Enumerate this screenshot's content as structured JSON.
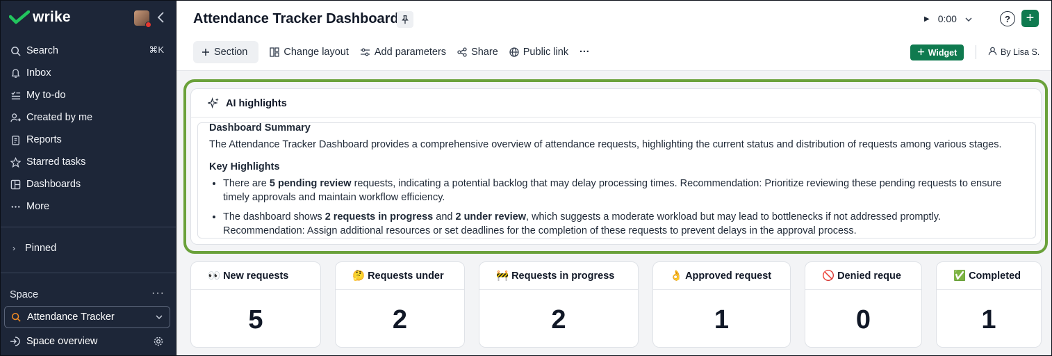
{
  "app": {
    "name": "wrike"
  },
  "sidebar": {
    "search": {
      "label": "Search",
      "shortcut": "⌘K"
    },
    "items": [
      {
        "label": "Inbox",
        "icon": "bell-icon"
      },
      {
        "label": "My to-do",
        "icon": "todo-list-icon"
      },
      {
        "label": "Created by me",
        "icon": "user-add-icon"
      },
      {
        "label": "Reports",
        "icon": "clipboard-icon"
      },
      {
        "label": "Starred tasks",
        "icon": "star-icon"
      },
      {
        "label": "Dashboards",
        "icon": "dashboard-icon"
      },
      {
        "label": "More",
        "icon": "more-dots-icon"
      }
    ],
    "pinned": "Pinned",
    "space_label": "Space",
    "space_select": "Attendance Tracker",
    "space_overview": "Space overview"
  },
  "header": {
    "title": "Attendance Tracker Dashboard",
    "timer": "0:00",
    "help": "?",
    "toolbar": {
      "section": "Section",
      "change_layout": "Change layout",
      "add_parameters": "Add parameters",
      "share": "Share",
      "public_link": "Public link",
      "more": "···",
      "widget": "Widget",
      "owner": "By Lisa S."
    }
  },
  "ai": {
    "title": "AI highlights",
    "summary_heading": "Dashboard Summary",
    "summary_text": "The Attendance Tracker Dashboard provides a comprehensive overview of attendance requests, highlighting the current status and distribution of requests among various stages.",
    "key_heading": "Key Highlights",
    "b1_pre": "There are ",
    "b1_bold": "5 pending review",
    "b1_post": " requests, indicating a potential backlog that may delay processing times. Recommendation: Prioritize reviewing these pending requests to ensure timely approvals and maintain workflow efficiency.",
    "b2_pre": "The dashboard shows ",
    "b2_bold1": "2 requests in progress",
    "b2_mid": " and ",
    "b2_bold2": "2 under review",
    "b2_post": ", which suggests a moderate workload but may lead to bottlenecks if not addressed promptly. Recommendation: Assign additional resources or set deadlines for the completion of these requests to prevent delays in the approval process."
  },
  "stats": [
    {
      "emoji": "👀",
      "label": "New requests",
      "value": "5"
    },
    {
      "emoji": "🤔",
      "label": "Requests under",
      "value": "2"
    },
    {
      "emoji": "🚧",
      "label": "Requests in progress",
      "value": "2"
    },
    {
      "emoji": "👌",
      "label": "Approved request",
      "value": "1"
    },
    {
      "emoji": "🚫",
      "label": "Denied reque",
      "value": "0"
    },
    {
      "emoji": "✅",
      "label": "Completed",
      "value": "1"
    }
  ],
  "colors": {
    "sidebar_bg": "#1d2638",
    "brand_green": "#0f7a4f",
    "highlight_outline": "#6aa13a"
  }
}
